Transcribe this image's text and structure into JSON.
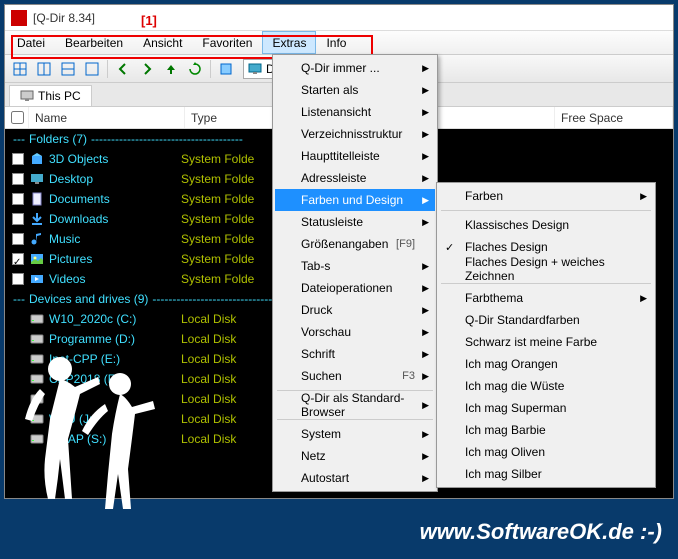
{
  "titlebar": {
    "title": "[Q-Dir 8.34]"
  },
  "annotation": "[1]",
  "menubar": {
    "items": [
      "Datei",
      "Bearbeiten",
      "Ansicht",
      "Favoriten",
      "Extras",
      "Info"
    ],
    "active_index": 4
  },
  "toolbar": {
    "address_text": "Desk"
  },
  "tab": {
    "label": "This PC"
  },
  "columns": {
    "check": "",
    "name": "Name",
    "type": "Type",
    "total": "",
    "free": "Free Space"
  },
  "groups": [
    {
      "title": "Folders (7)",
      "items": [
        {
          "name": "3D Objects",
          "type": "System Folde",
          "icon": "cube",
          "checked": false
        },
        {
          "name": "Desktop",
          "type": "System Folde",
          "icon": "desktop",
          "checked": false
        },
        {
          "name": "Documents",
          "type": "System Folde",
          "icon": "doc",
          "checked": false
        },
        {
          "name": "Downloads",
          "type": "System Folde",
          "icon": "download",
          "checked": false
        },
        {
          "name": "Music",
          "type": "System Folde",
          "icon": "music",
          "checked": false
        },
        {
          "name": "Pictures",
          "type": "System Folde",
          "icon": "picture",
          "checked": true
        },
        {
          "name": "Videos",
          "type": "System Folde",
          "icon": "video",
          "checked": false
        }
      ]
    },
    {
      "title": "Devices and drives (9)",
      "items": [
        {
          "name": "W10_2020c (C:)",
          "type": "Local Disk",
          "icon": "disk"
        },
        {
          "name": "Programme (D:)",
          "type": "Local Disk",
          "icon": "disk"
        },
        {
          "name": "Inet-CPP (E:)",
          "type": "Local Disk",
          "icon": "disk"
        },
        {
          "name": "CPP2018 (F:)",
          "type": "Local Disk",
          "icon": "disk"
        },
        {
          "name": "",
          "type": "Local Disk",
          "icon": "disk"
        },
        {
          "name": "W7U (J:)",
          "type": "Local Disk",
          "icon": "disk"
        },
        {
          "name": "SWAP (S:)",
          "type": "Local Disk",
          "icon": "disk"
        }
      ]
    }
  ],
  "dropdown": [
    {
      "label": "Q-Dir immer ...",
      "arrow": true
    },
    {
      "label": "Starten als",
      "arrow": true
    },
    {
      "label": "Listenansicht",
      "arrow": true
    },
    {
      "label": "Verzeichnisstruktur",
      "arrow": true
    },
    {
      "label": "Haupttitelleiste",
      "arrow": true
    },
    {
      "label": "Adressleiste",
      "arrow": true
    },
    {
      "label": "Farben und Design",
      "arrow": true,
      "highlighted": true
    },
    {
      "label": "Statusleiste",
      "arrow": true
    },
    {
      "label": "Größenangaben",
      "shortcut": "[F9]"
    },
    {
      "label": "Tab-s",
      "arrow": true
    },
    {
      "label": "Dateioperationen",
      "arrow": true
    },
    {
      "label": "Druck",
      "arrow": true
    },
    {
      "label": "Vorschau",
      "arrow": true
    },
    {
      "label": "Schrift",
      "arrow": true
    },
    {
      "label": "Suchen",
      "shortcut": "F3",
      "arrow": true
    },
    {
      "sep": true
    },
    {
      "label": "Q-Dir als Standard-Browser",
      "arrow": true
    },
    {
      "sep": true
    },
    {
      "label": "System",
      "arrow": true
    },
    {
      "label": "Netz",
      "arrow": true
    },
    {
      "label": "Autostart",
      "arrow": true
    }
  ],
  "submenu": [
    {
      "label": "Farben",
      "arrow": true
    },
    {
      "sep": true
    },
    {
      "label": "Klassisches Design"
    },
    {
      "label": "Flaches Design",
      "checked": true
    },
    {
      "label": "Flaches Design + weiches Zeichnen"
    },
    {
      "sep": true
    },
    {
      "label": "Farbthema",
      "arrow": true
    },
    {
      "label": "Q-Dir Standardfarben"
    },
    {
      "label": "Schwarz ist meine Farbe"
    },
    {
      "label": "Ich mag Orangen"
    },
    {
      "label": "Ich mag die Wüste"
    },
    {
      "label": "Ich mag Superman"
    },
    {
      "label": "Ich mag Barbie"
    },
    {
      "label": "Ich mag Oliven"
    },
    {
      "label": "Ich mag Silber"
    }
  ],
  "footer": {
    "url": "www.SoftwareOK.de :-)"
  }
}
